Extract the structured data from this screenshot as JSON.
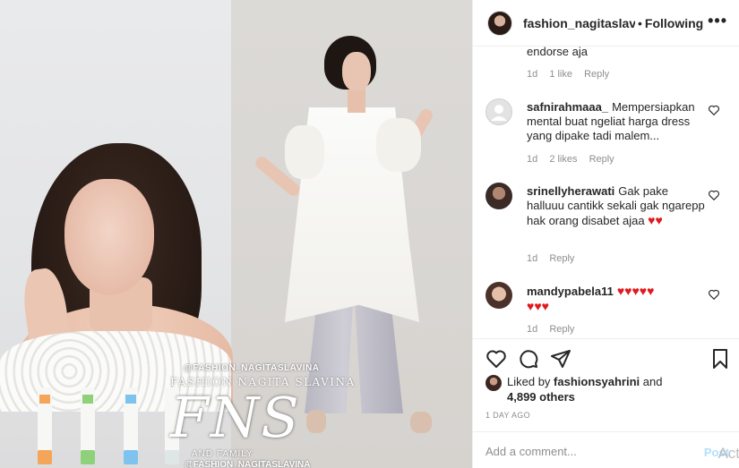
{
  "post": {
    "watermark_handle": "@FASHION_NAGITASLAVINA",
    "watermark_name": "FASHION NAGITA SLAVINA",
    "watermark_logo": "FNS",
    "watermark_family": "AND FAMILY",
    "watermark_handle2": "@FASHION_NAGITASLAVINA"
  },
  "header": {
    "username": "fashion_nagitaslavina",
    "separator": "•",
    "follow_label": "Following",
    "more_icon": "more-dots-icon"
  },
  "comments": [
    {
      "user": "",
      "text": "endorse aja",
      "time": "1d",
      "likes": "1 like",
      "reply": "Reply"
    },
    {
      "user": "safnirahmaaa_",
      "text": "Mempersiapkan mental buat ngeliat harga dress yang dipake tadi malem...",
      "time": "1d",
      "likes": "2 likes",
      "reply": "Reply"
    },
    {
      "user": "srinellyherawati",
      "text": "Gak pake halluuu cantikk sekali gak ngarepp hak orang disabet ajaa",
      "emoji": "♥♥",
      "time": "1d",
      "reply": "Reply"
    },
    {
      "user": "mandypabela11",
      "emoji1": "♥♥♥♥♥",
      "emoji2": "♥♥♥",
      "time": "1d",
      "reply": "Reply"
    }
  ],
  "likes": {
    "prefix": "Liked by",
    "user": "fashionsyahrini",
    "suffix": "and",
    "others": "4,899 others"
  },
  "time_ago": "1 DAY AGO",
  "add_comment": {
    "placeholder": "Add a comment...",
    "post_label": "Post"
  },
  "overlay_text": "Act",
  "colors": {
    "heart_red": "#e0191e",
    "muted": "#8e8e8e",
    "post_blue": "#b2dffc"
  }
}
